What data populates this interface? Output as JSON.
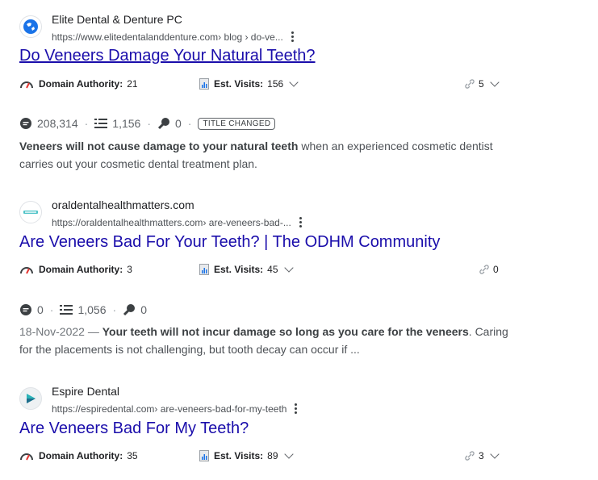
{
  "results": [
    {
      "site_name": "Elite Dental & Denture PC",
      "url": "https://www.elitedentalanddenture.com",
      "url_path": " › blog › do-ve...",
      "title": "Do Veneers Damage Your Natural Teeth?",
      "domain_authority_label": "Domain Authority:",
      "domain_authority": "21",
      "est_visits_label": "Est. Visits:",
      "est_visits": "156",
      "links": "5",
      "stats": {
        "a": "208,314",
        "b": "1,156",
        "c": "0",
        "badge": "TITLE CHANGED"
      },
      "snippet_bold": "Veneers will not cause damage to your natural teeth",
      "snippet_rest": " when an experienced cosmetic dentist carries out your cosmetic dental treatment plan."
    },
    {
      "site_name": "oraldentalhealthmatters.com",
      "url": "https://oraldentalhealthmatters.com",
      "url_path": " › are-veneers-bad-...",
      "title": "Are Veneers Bad For Your Teeth? | The ODHM Community",
      "domain_authority_label": "Domain Authority:",
      "domain_authority": "3",
      "est_visits_label": "Est. Visits:",
      "est_visits": "45",
      "links": "0",
      "stats": {
        "a": "0",
        "b": "1,056",
        "c": "0"
      },
      "snippet_date": "18-Nov-2022 — ",
      "snippet_bold": "Your teeth will not incur damage so long as you care for the veneers",
      "snippet_rest": ". Caring for the placements is not challenging, but tooth decay can occur if ..."
    },
    {
      "site_name": "Espire Dental",
      "url": "https://espiredental.com",
      "url_path": " › are-veneers-bad-for-my-teeth",
      "title": "Are Veneers Bad For My Teeth?",
      "domain_authority_label": "Domain Authority:",
      "domain_authority": "35",
      "est_visits_label": "Est. Visits:",
      "est_visits": "89",
      "links": "3"
    }
  ],
  "colors": {
    "title": "#1a0dab",
    "text": "#202124",
    "muted": "#4d5156"
  },
  "icons": [
    "globe-icon",
    "gauge-icon",
    "chart-doc-icon",
    "link-icon",
    "chevron-down-icon",
    "kebab-menu-icon",
    "search-bubble-icon",
    "list-icon",
    "key-icon"
  ]
}
